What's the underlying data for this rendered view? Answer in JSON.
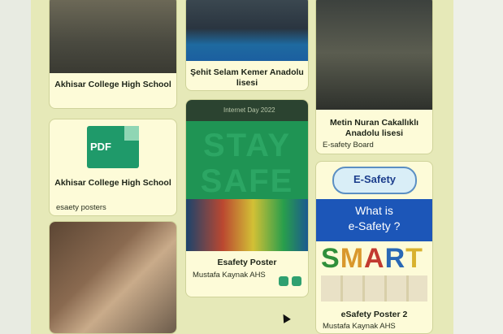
{
  "cards": [
    {
      "title": "Akhisar College High School"
    },
    {
      "title": "Şehit Selam Kemer Anadolu lisesi"
    },
    {
      "title": "Metin Nuran Cakallıklı Anadolu lisesi",
      "subtitle": "E-safety Board"
    },
    {
      "title": "Akhisar College High School",
      "subtitle": "esaety posters",
      "file_label": "PDF"
    },
    {
      "title": "Esafety Poster",
      "subtitle": "Mustafa Kaynak AHS",
      "header_text": "Internet Day 2022",
      "poster_word1": "STAY",
      "poster_word2": "SAFE"
    },
    {
      "title": "eSafety Poster 2",
      "subtitle": "Mustafa Kaynak AHS",
      "logo_text": "E-Safety",
      "question_line1": "What is",
      "question_line2": "e-Safety ?",
      "smart_letters": [
        "S",
        "M",
        "A",
        "R",
        "T"
      ]
    }
  ]
}
